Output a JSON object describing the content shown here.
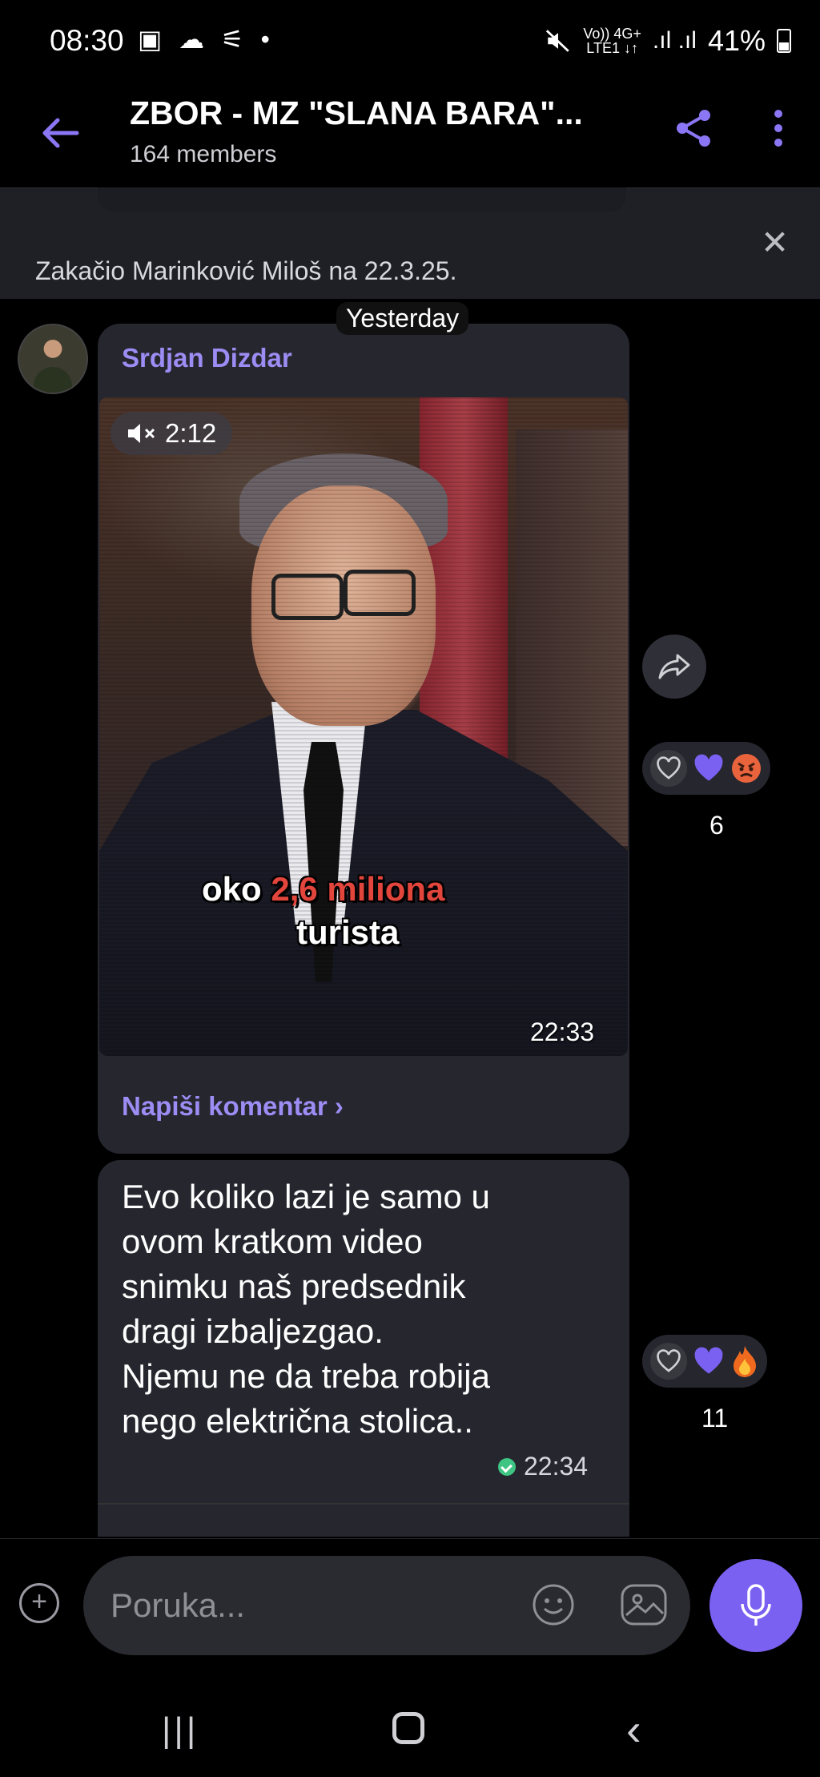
{
  "status": {
    "time": "08:30",
    "left_icons": "▣ ☁ ⚟ •",
    "network_top": "Vo)) 4G+",
    "network_bottom": "LTE1 ↓↑",
    "signal": ".ıl .ıl",
    "battery": "41%"
  },
  "header": {
    "title": "ZBOR - MZ \"SLANA BARA\"...",
    "subtitle": "164 members"
  },
  "pinned": {
    "text": "Zakačio Marinković Miloš na 22.3.25."
  },
  "date_separator": "Yesterday",
  "message1": {
    "sender": "Srdjan Dizdar",
    "video_duration": "2:12",
    "caption_prefix": "oko ",
    "caption_highlight": "2,6 miliona",
    "caption_line2": "turista",
    "time": "22:33",
    "comment_link": "Napiši komentar ›",
    "reaction_count": "6"
  },
  "message2": {
    "text_lines": [
      "Evo koliko lazi je samo u",
      "ovom kratkom video",
      "snimku naš predsednik",
      "dragi izbaljezgao.",
      "Njemu ne da treba robija",
      "nego električna stolica.."
    ],
    "time": "22:34",
    "reaction_count": "11"
  },
  "composer": {
    "placeholder": "Poruka..."
  },
  "nav": {
    "recent": "|||",
    "back": "‹"
  },
  "colors": {
    "accent": "#7b61f2",
    "name": "#9d8cf3",
    "bubble": "#26262f"
  }
}
